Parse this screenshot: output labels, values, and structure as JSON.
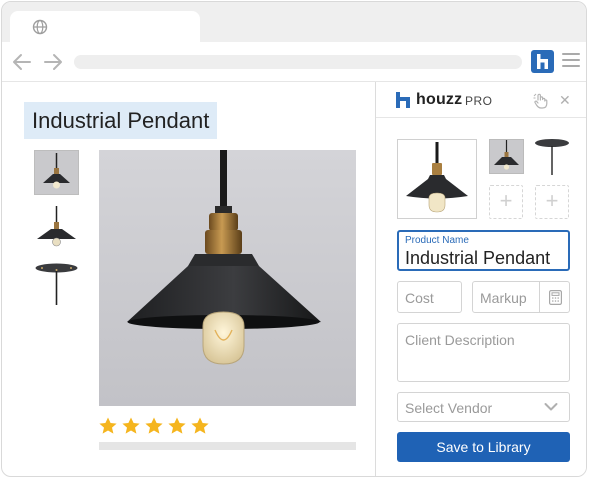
{
  "browser": {
    "tab_icon": "globe-icon",
    "back_icon": "arrow-left-icon",
    "forward_icon": "arrow-right-icon",
    "extension_icon": "houzz-h-icon",
    "menu_icon": "hamburger-icon"
  },
  "product": {
    "title": "Industrial Pendant",
    "rating_stars": 5,
    "star_color": "#f5b51e"
  },
  "sidebar": {
    "brand_name": "houzz",
    "brand_suffix": "PRO",
    "brand_color": "#2a6bb8",
    "close_label": "✕",
    "add_slot_label": "+",
    "fields": {
      "product_name_label": "Product Name",
      "product_name_value": "Industrial Pendant",
      "cost_placeholder": "Cost",
      "markup_placeholder": "Markup",
      "client_description_placeholder": "Client Description",
      "vendor_placeholder": "Select Vendor"
    },
    "save_label": "Save to Library",
    "save_color": "#1f62b5"
  }
}
